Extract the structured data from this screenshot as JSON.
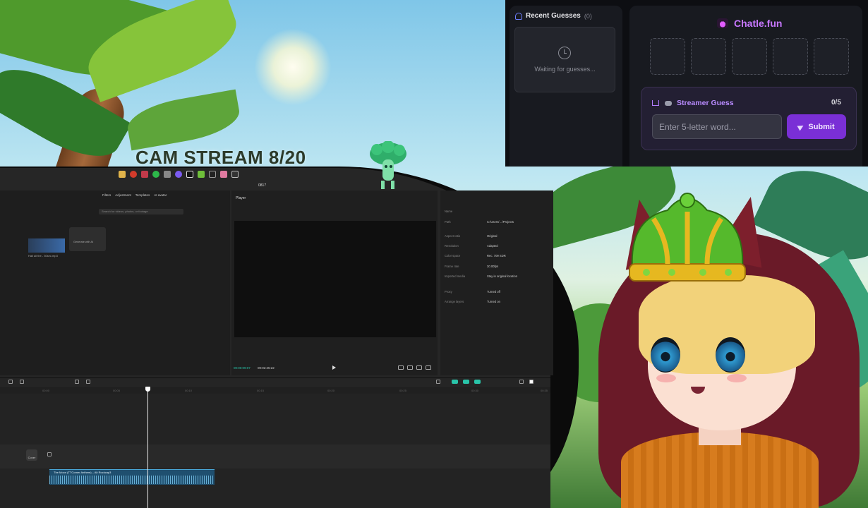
{
  "stream": {
    "title": "CAM STREAM 8/20"
  },
  "editor": {
    "project_name": "0817",
    "media_tabs": [
      "Filters",
      "Adjustment",
      "Templates",
      "AI avatar"
    ],
    "search_placeholder": "Search for videos, photos, or footage",
    "clip_label": "Hail all the - 30sec.mp3",
    "generate_label": "Generate with AI",
    "player_title": "Player",
    "time_current": "00:00:09:07",
    "time_total": "00:02:25:22",
    "properties": [
      {
        "label": "Name",
        "value": ""
      },
      {
        "label": "Path",
        "value": "C:/Users/…/Projects"
      },
      {
        "label": "Aspect ratio",
        "value": "Original"
      },
      {
        "label": "Resolution",
        "value": "Adapted"
      },
      {
        "label": "Color space",
        "value": "Rec. 709 SDR"
      },
      {
        "label": "Frame rate",
        "value": "30.00fps"
      },
      {
        "label": "Imported media",
        "value": "Stay in original location"
      },
      {
        "label": "Proxy",
        "value": "Turned off"
      },
      {
        "label": "Arrange layers",
        "value": "Turned on"
      }
    ],
    "ruler_ticks": [
      "00:00",
      "00:05",
      "00:10",
      "00:15",
      "00:20",
      "00:25",
      "00:30",
      "00:35"
    ],
    "cover_label": "Cover",
    "audio_clip_label": "The Moon (TTCorner Anthem) – Alt Rockcap3"
  },
  "recent_guesses": {
    "title": "Recent Guesses",
    "count": "(0)",
    "empty_text": "Waiting for guesses...",
    "icons": [
      "users-icon",
      "clock-icon"
    ]
  },
  "chatle": {
    "brand": "Chatle.fun",
    "tile_count": 5,
    "streamer_guess_title": "Streamer Guess",
    "guess_progress": "0/5",
    "input_placeholder": "Enter 5-letter word...",
    "input_value": "",
    "submit_label": "Submit",
    "colors": {
      "accent": "#7a2fd6",
      "brand": "#c777ff"
    }
  }
}
